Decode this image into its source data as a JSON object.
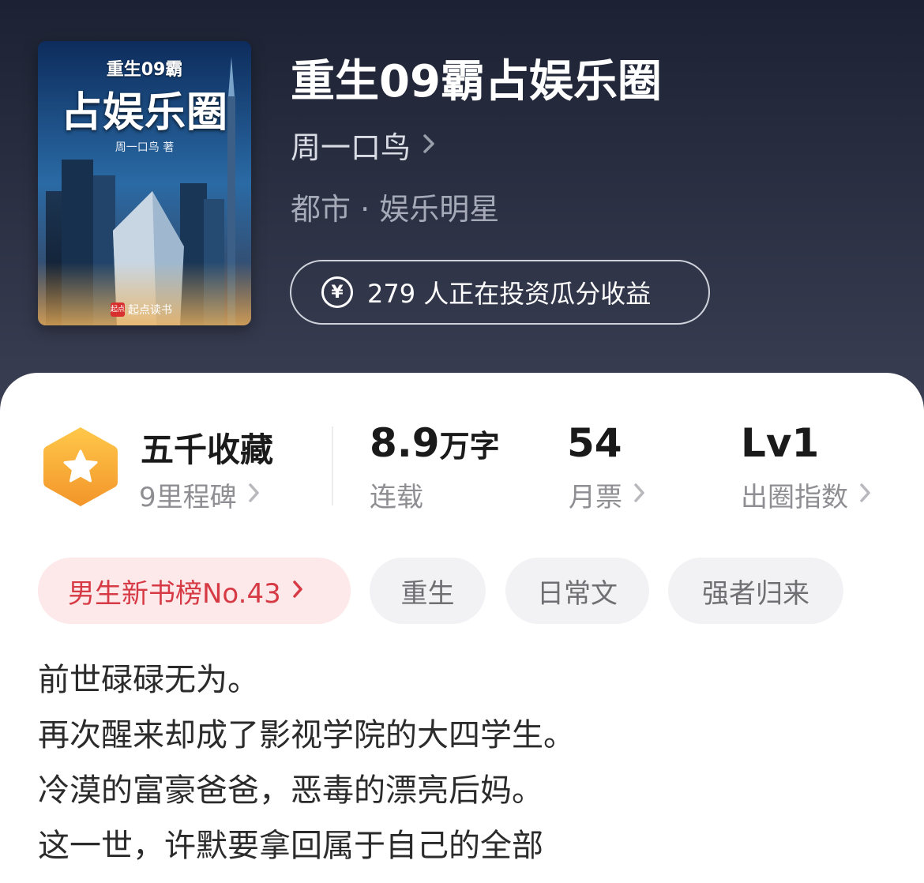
{
  "book": {
    "title": "重生09霸占娱乐圈",
    "author": "周一口鸟",
    "genre": "都市 · 娱乐明星",
    "invest_text": "279 人正在投资瓜分收益"
  },
  "cover": {
    "small_title": "重生09霸",
    "big_title": "占娱乐圈",
    "author": "周一口鸟 著",
    "publisher": "起点读书",
    "publisher_logo": "起点"
  },
  "stats": [
    {
      "title": "五千收藏",
      "sub": "9里程碑"
    },
    {
      "value": "8.9",
      "unit": "万字",
      "sub": "连载"
    },
    {
      "value": "54",
      "sub": "月票"
    },
    {
      "value": "Lv1",
      "sub": "出圈指数"
    }
  ],
  "tags": [
    {
      "label": "男生新书榜No.43"
    },
    {
      "label": "重生"
    },
    {
      "label": "日常文"
    },
    {
      "label": "强者归来"
    }
  ],
  "synopsis": [
    "前世碌碌无为。",
    "再次醒来却成了影视学院的大四学生。",
    "冷漠的富豪爸爸，恶毒的漂亮后妈。",
    "这一世，许默要拿回属于自己的全部"
  ],
  "icons": {
    "yen": "yen-circle-icon",
    "badge": "star-hexagon-icon",
    "chevron": "chevron-right-icon"
  },
  "colors": {
    "header_bg": "#2a2f42",
    "rank_tag_bg": "#fde8ea",
    "rank_tag_text": "#d63a45",
    "badge_gold": "#f5a623"
  }
}
